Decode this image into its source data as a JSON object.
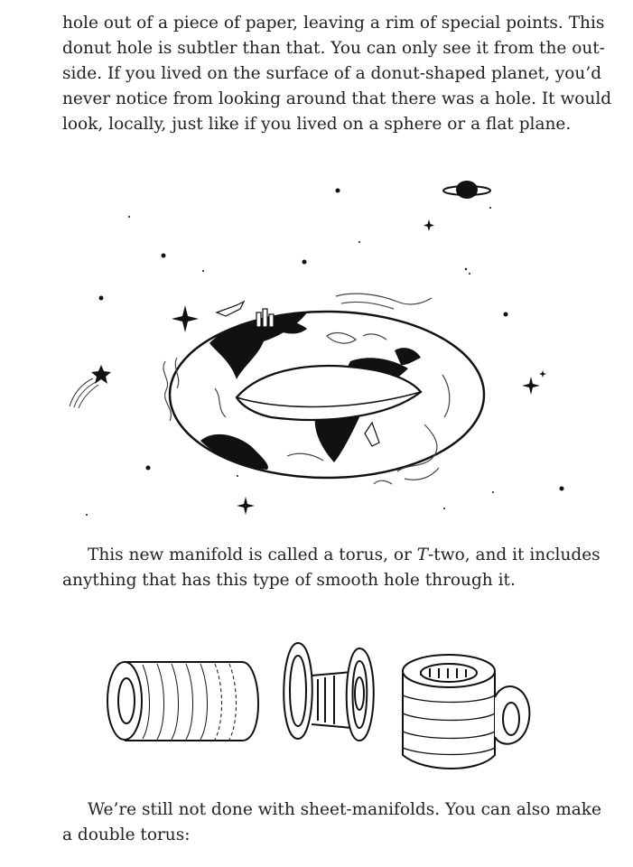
{
  "page": {
    "para1_lines": [
      "hole out of a piece of paper, leaving a rim of special points. This",
      "donut hole is subtler than that. You can only see it from the out-",
      "side. If you lived on the surface of a donut-shaped planet, you’d",
      "never notice from looking around that there was a hole. It would",
      "look, locally, just like if you lived on a sphere or a flat plane."
    ],
    "para2_line1_pre": "This new manifold is called a torus, or ",
    "para2_line1_em": "T",
    "para2_line1_post": "-two, and it includes",
    "para2_line2": "anything that has this type of smooth hole through it.",
    "para3_lines": [
      "We’re still not done with sheet-manifolds. You can also make",
      "a double torus:"
    ]
  }
}
